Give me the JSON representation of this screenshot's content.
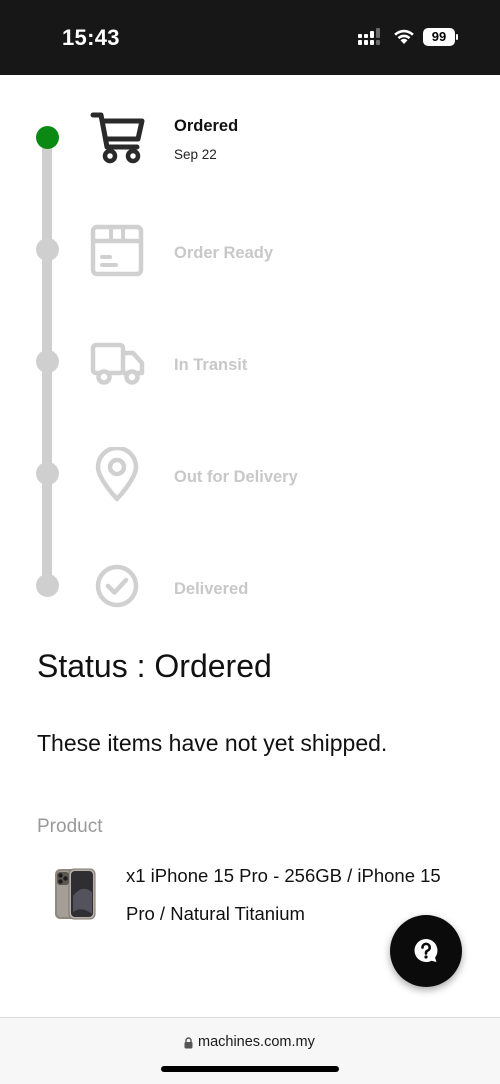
{
  "status_bar": {
    "time": "15:43",
    "battery": "99"
  },
  "timeline": {
    "steps": [
      {
        "label": "Ordered",
        "date": "Sep 22",
        "icon": "cart-icon",
        "active": true
      },
      {
        "label": "Order Ready",
        "icon": "box-icon",
        "active": false
      },
      {
        "label": "In Transit",
        "icon": "truck-icon",
        "active": false
      },
      {
        "label": "Out for Delivery",
        "icon": "location-pin-icon",
        "active": false
      },
      {
        "label": "Delivered",
        "icon": "check-circle-icon",
        "active": false
      }
    ],
    "colors": {
      "active_dot": "#0a8a12",
      "inactive": "#cfcfcf"
    }
  },
  "status": {
    "heading": "Status : Ordered",
    "message": "These items have not yet shipped."
  },
  "product": {
    "label": "Product",
    "item": "x1 iPhone 15 Pro - 256GB / iPhone 15 Pro / Natural Titanium"
  },
  "browser": {
    "url": "machines.com.my"
  }
}
